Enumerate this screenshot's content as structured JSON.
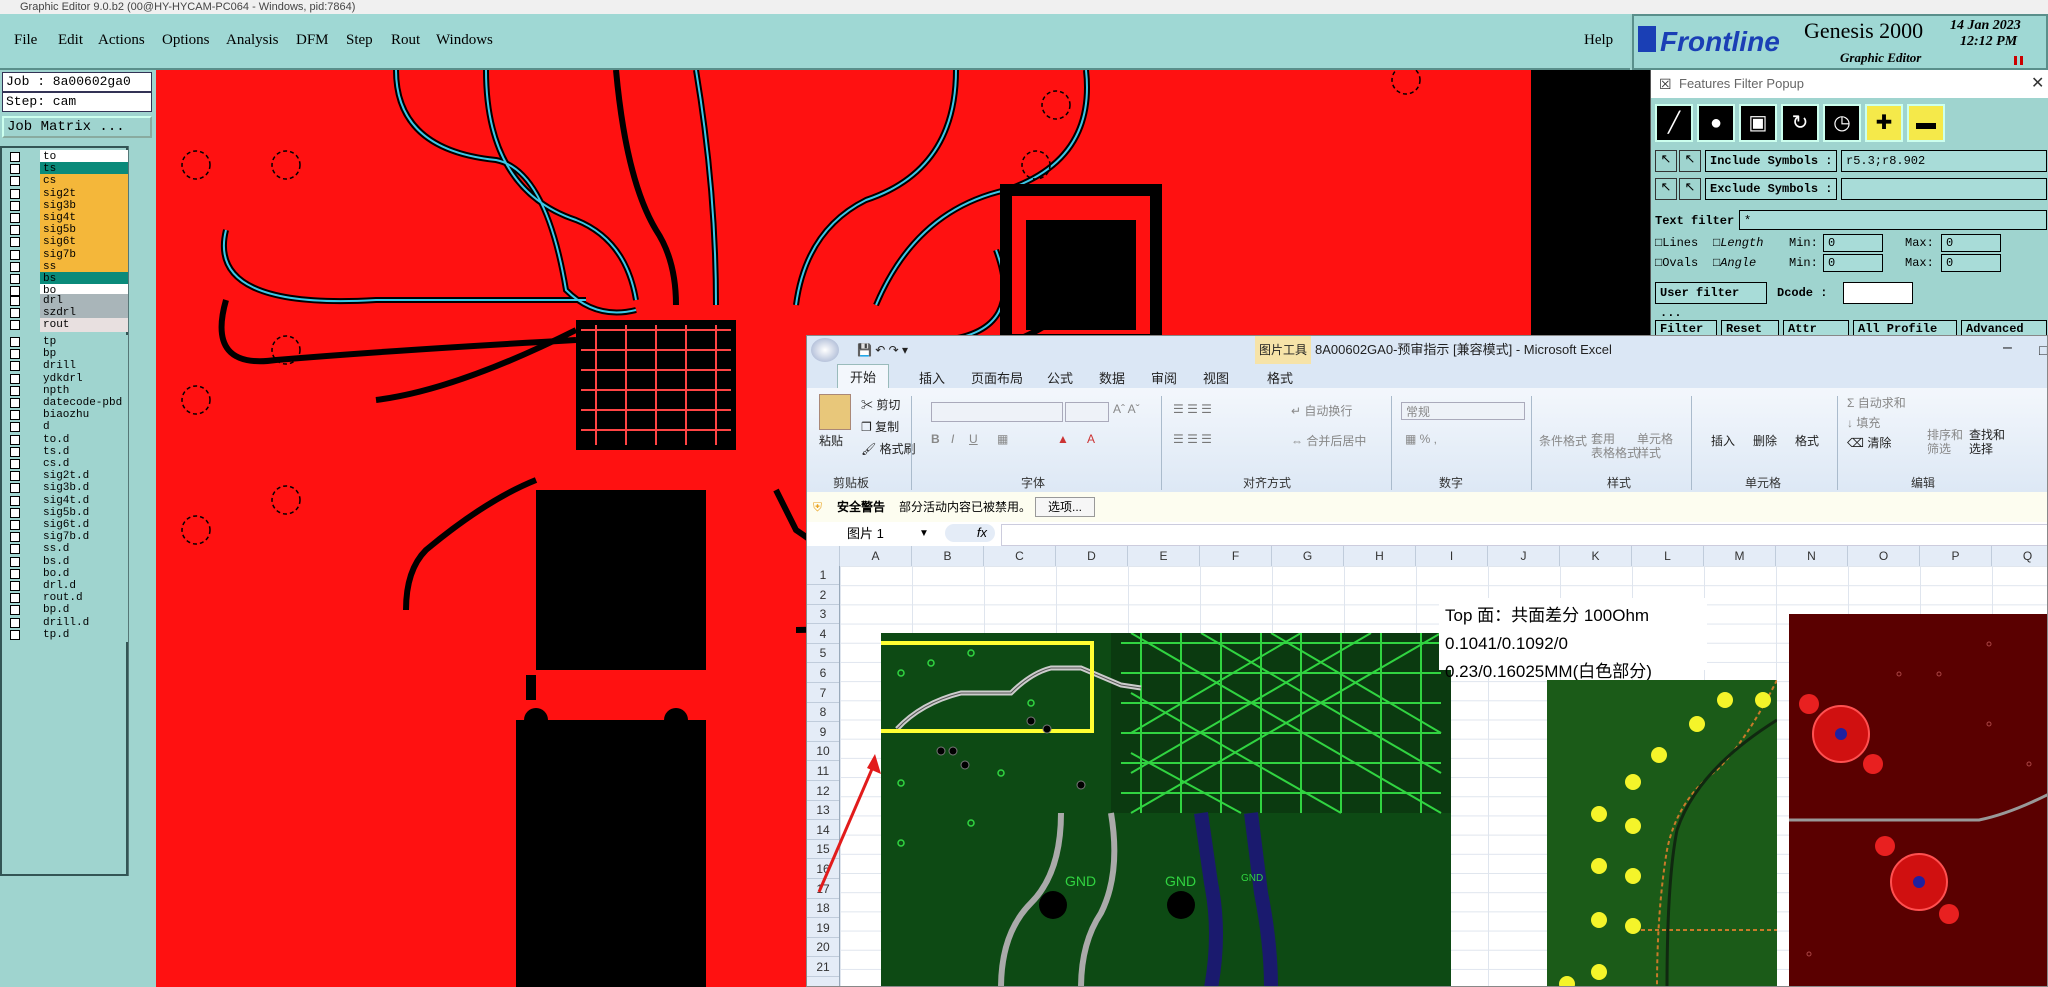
{
  "window_title": "Graphic Editor 9.0.b2 (00@HY-HYCAM-PC064 - Windows, pid:7864)",
  "menu": [
    "File",
    "Edit",
    "Actions",
    "Options",
    "Analysis",
    "DFM",
    "Step",
    "Rout",
    "Windows"
  ],
  "help_label": "Help",
  "brand": {
    "logo": "Frontline",
    "product": "Genesis 2000",
    "subtitle": "Graphic Editor",
    "date": "14 Jan 2023",
    "time": "12:12 PM"
  },
  "job": {
    "job_label": "Job : 8a00602ga0",
    "step_label": "Step: cam",
    "matrix_button": "Job Matrix ..."
  },
  "layers_group1": [
    {
      "name": "to",
      "bg": "#ffffff"
    },
    {
      "name": "ts",
      "bg": "#0a8a7a"
    },
    {
      "name": "cs",
      "bg": "#f4b73a"
    },
    {
      "name": "sig2t",
      "bg": "#f4b73a"
    },
    {
      "name": "sig3b",
      "bg": "#f4b73a"
    },
    {
      "name": "sig4t",
      "bg": "#f4b73a"
    },
    {
      "name": "sig5b",
      "bg": "#f4b73a"
    },
    {
      "name": "sig6t",
      "bg": "#f4b73a"
    },
    {
      "name": "sig7b",
      "bg": "#f4b73a"
    },
    {
      "name": "ss",
      "bg": "#f4b73a"
    },
    {
      "name": "bs",
      "bg": "#0a8a7a"
    },
    {
      "name": "bo",
      "bg": "#ffffff"
    }
  ],
  "layers_group2": [
    {
      "name": "drl",
      "bg": "#a9b5b9"
    },
    {
      "name": "szdrl",
      "bg": "#a9b5b9"
    },
    {
      "name": "rout",
      "bg": "#e8e0e0"
    }
  ],
  "layers_group3": [
    "tp",
    "bp",
    "drill",
    "ydkdrl",
    "npth",
    "datecode-pbd",
    "biaozhu",
    "d",
    "to.d",
    "ts.d",
    "cs.d",
    "sig2t.d",
    "sig3b.d",
    "sig4t.d",
    "sig5b.d",
    "sig6t.d",
    "sig7b.d",
    "ss.d",
    "bs.d",
    "bo.d",
    "drl.d",
    "rout.d",
    "bp.d",
    "drill.d",
    "tp.d"
  ],
  "features_popup": {
    "title": "Features Filter Popup",
    "include_label": "Include Symbols :",
    "include_value": "r5.3;r8.902",
    "exclude_label": "Exclude Symbols :",
    "exclude_value": "",
    "text_filter_label": "Text filter",
    "text_filter_value": "*",
    "lines_label": "Lines",
    "ovals_label": "Ovals",
    "length_label": "Length",
    "angle_label": "Angle",
    "min_label": "Min:",
    "max_label": "Max:",
    "zero": "0",
    "user_filter": "User filter ...",
    "dcode_label": "Dcode :",
    "bottom_buttons": [
      "Filter",
      "Reset",
      "Attr",
      "All Profile",
      "Advanced"
    ]
  },
  "excel": {
    "context_tab": "图片工具",
    "title": "8A00602GA0-预审指示  [兼容模式] - Microsoft Excel",
    "tabs": [
      "开始",
      "插入",
      "页面布局",
      "公式",
      "数据",
      "审阅",
      "视图",
      "格式"
    ],
    "clipboard": {
      "paste": "粘贴",
      "cut": "剪切",
      "copy": "复制",
      "format_painter": "格式刷",
      "group": "剪贴板"
    },
    "font_group": "字体",
    "align_group": "对齐方式",
    "number_group": "数字",
    "styles_group": "样式",
    "cells_group": "单元格",
    "edit_group": "编辑",
    "wrap": "自动换行",
    "merge": "合并后居中",
    "number_format": "常规",
    "cond_format": "条件格式",
    "table_format": "套用\n表格格式",
    "cell_style": "单元格\n样式",
    "insert": "插入",
    "delete": "删除",
    "format": "格式",
    "autosum": "自动求和",
    "fill": "填充",
    "clear": "清除",
    "sort": "排序和\n筛选",
    "find": "查找和\n选择",
    "warn_title": "安全警告",
    "warn_text": "部分活动内容已被禁用。",
    "warn_button": "选项...",
    "name_box": "图片 1",
    "fx": "fx",
    "columns": [
      "A",
      "B",
      "C",
      "D",
      "E",
      "F",
      "G",
      "H",
      "I",
      "J",
      "K",
      "L",
      "M",
      "N",
      "O",
      "P",
      "Q"
    ],
    "rows": [
      "1",
      "2",
      "3",
      "4",
      "5",
      "6",
      "7",
      "8",
      "9",
      "10",
      "11",
      "12",
      "13",
      "14",
      "15",
      "16",
      "17",
      "18",
      "19",
      "20",
      "21"
    ],
    "note_line1": "Top 面：共面差分 100Ohm 0.1041/0.1092/0",
    "note_line2": "0.23/0.16025MM(白色部分)",
    "gnd_labels": [
      "GND",
      "GND",
      "GND"
    ]
  },
  "colors": {
    "canvas": "#ff1111",
    "panel": "#9fd4cf",
    "accent": "#0a8a7a"
  }
}
